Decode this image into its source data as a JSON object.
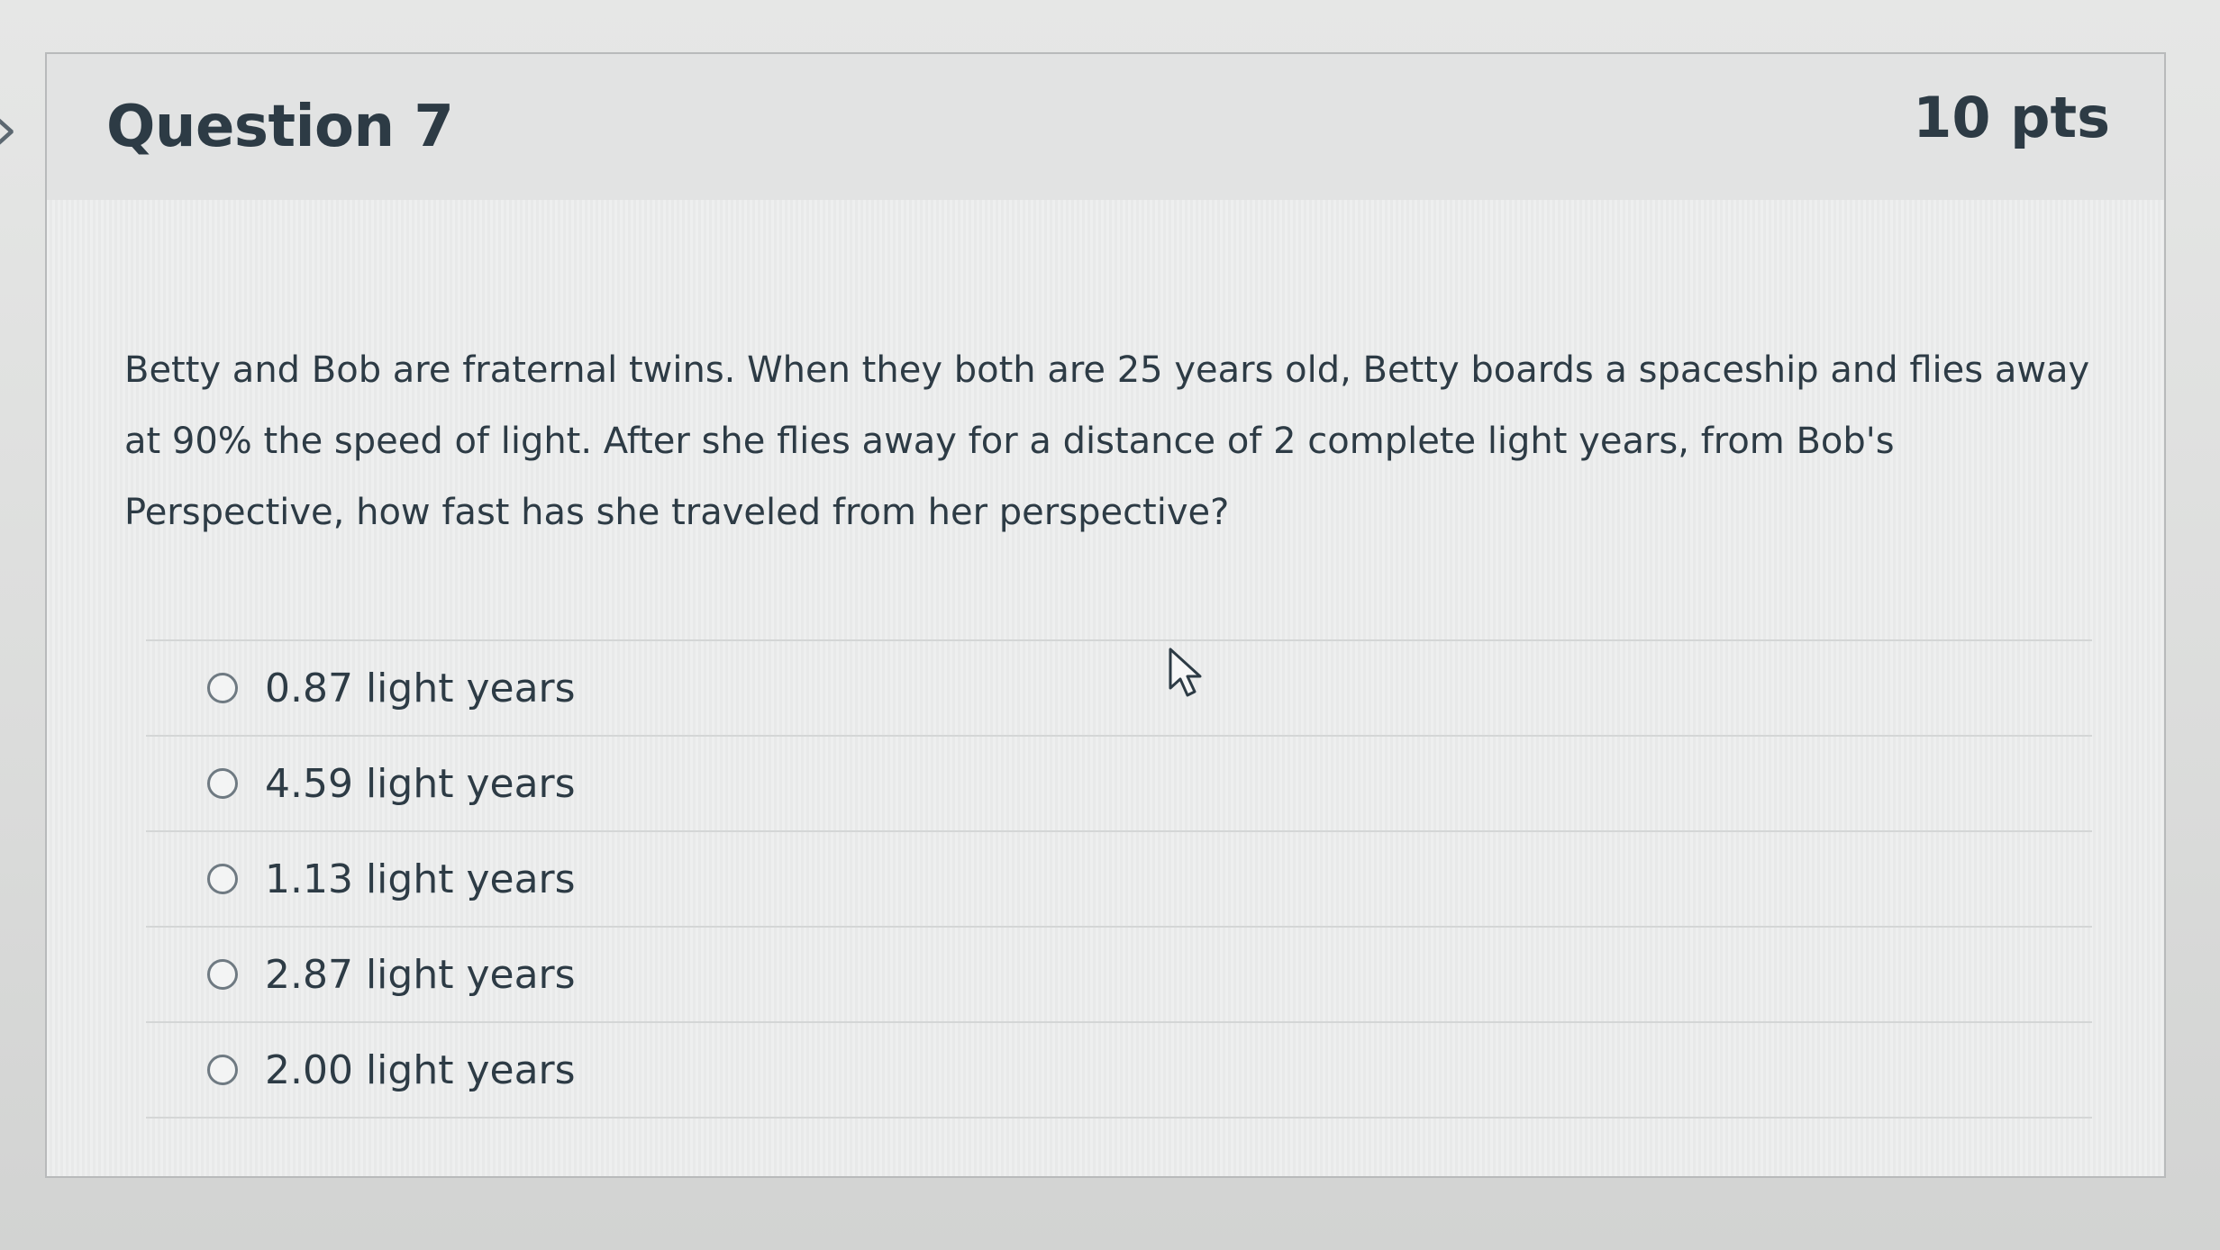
{
  "question": {
    "title": "Question 7",
    "points": "10 pts",
    "text": "Betty and Bob are fraternal twins.  When they both are 25 years old, Betty boards a spaceship and flies away at 90% the speed of light.  After she flies away for a distance of 2 complete light years, from Bob's Perspective, how fast has she traveled from her perspective?"
  },
  "answers": [
    {
      "label": "0.87 light years"
    },
    {
      "label": "4.59 light years"
    },
    {
      "label": "1.13 light years"
    },
    {
      "label": "2.87 light years"
    },
    {
      "label": "2.00 light years"
    }
  ],
  "icons": {
    "nav": "chevron-right-icon",
    "pointer": "mouse-pointer-icon",
    "radio": "radio-unchecked-icon"
  },
  "colors": {
    "text": "#2d3b45",
    "border": "#b8babb",
    "header_background": "#e2e3e3",
    "body_background": "#ebecec"
  }
}
